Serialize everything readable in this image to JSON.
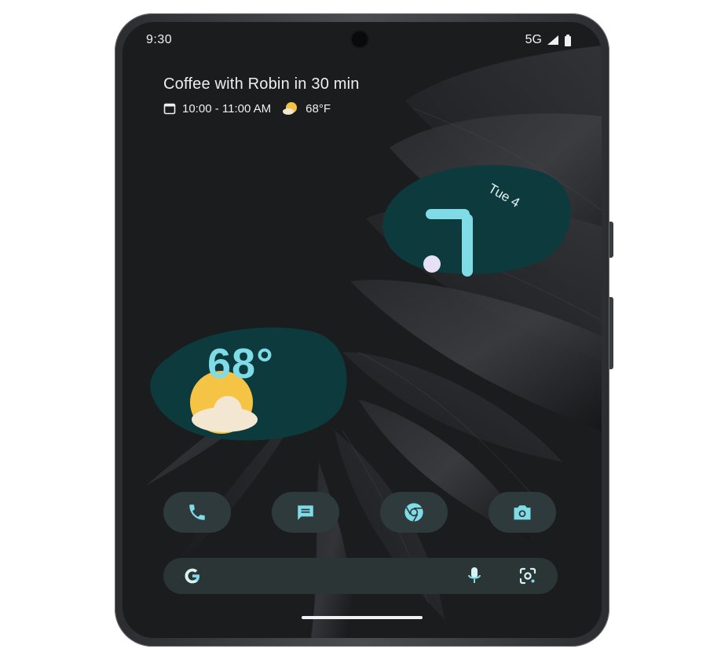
{
  "status_bar": {
    "time": "9:30",
    "network": "5G",
    "icons": [
      "signal-icon",
      "battery-icon"
    ]
  },
  "at_a_glance": {
    "title": "Coffee with Robin in 30 min",
    "time_range": "10:00 - 11:00 AM",
    "temperature": "68°F",
    "icons": [
      "calendar-icon",
      "partly-sunny-icon"
    ]
  },
  "clock_widget": {
    "date": "Tue 4"
  },
  "weather_widget": {
    "temperature": "68°",
    "icon": "partly-sunny-icon"
  },
  "dock": {
    "apps": [
      {
        "name": "Phone",
        "icon": "phone-icon"
      },
      {
        "name": "Messages",
        "icon": "messages-icon"
      },
      {
        "name": "Chrome",
        "icon": "chrome-icon"
      },
      {
        "name": "Camera",
        "icon": "camera-icon"
      }
    ]
  },
  "search_bar": {
    "logo": "G",
    "icons": [
      "google-g-icon",
      "mic-icon",
      "lens-icon"
    ]
  },
  "colors": {
    "widget_bg": "#0c3a3d",
    "accent_teal": "#7fdbe6",
    "sun_yellow": "#f6c445",
    "dock_btn_bg": "#2e3a3c",
    "search_bg": "#2b3536"
  }
}
